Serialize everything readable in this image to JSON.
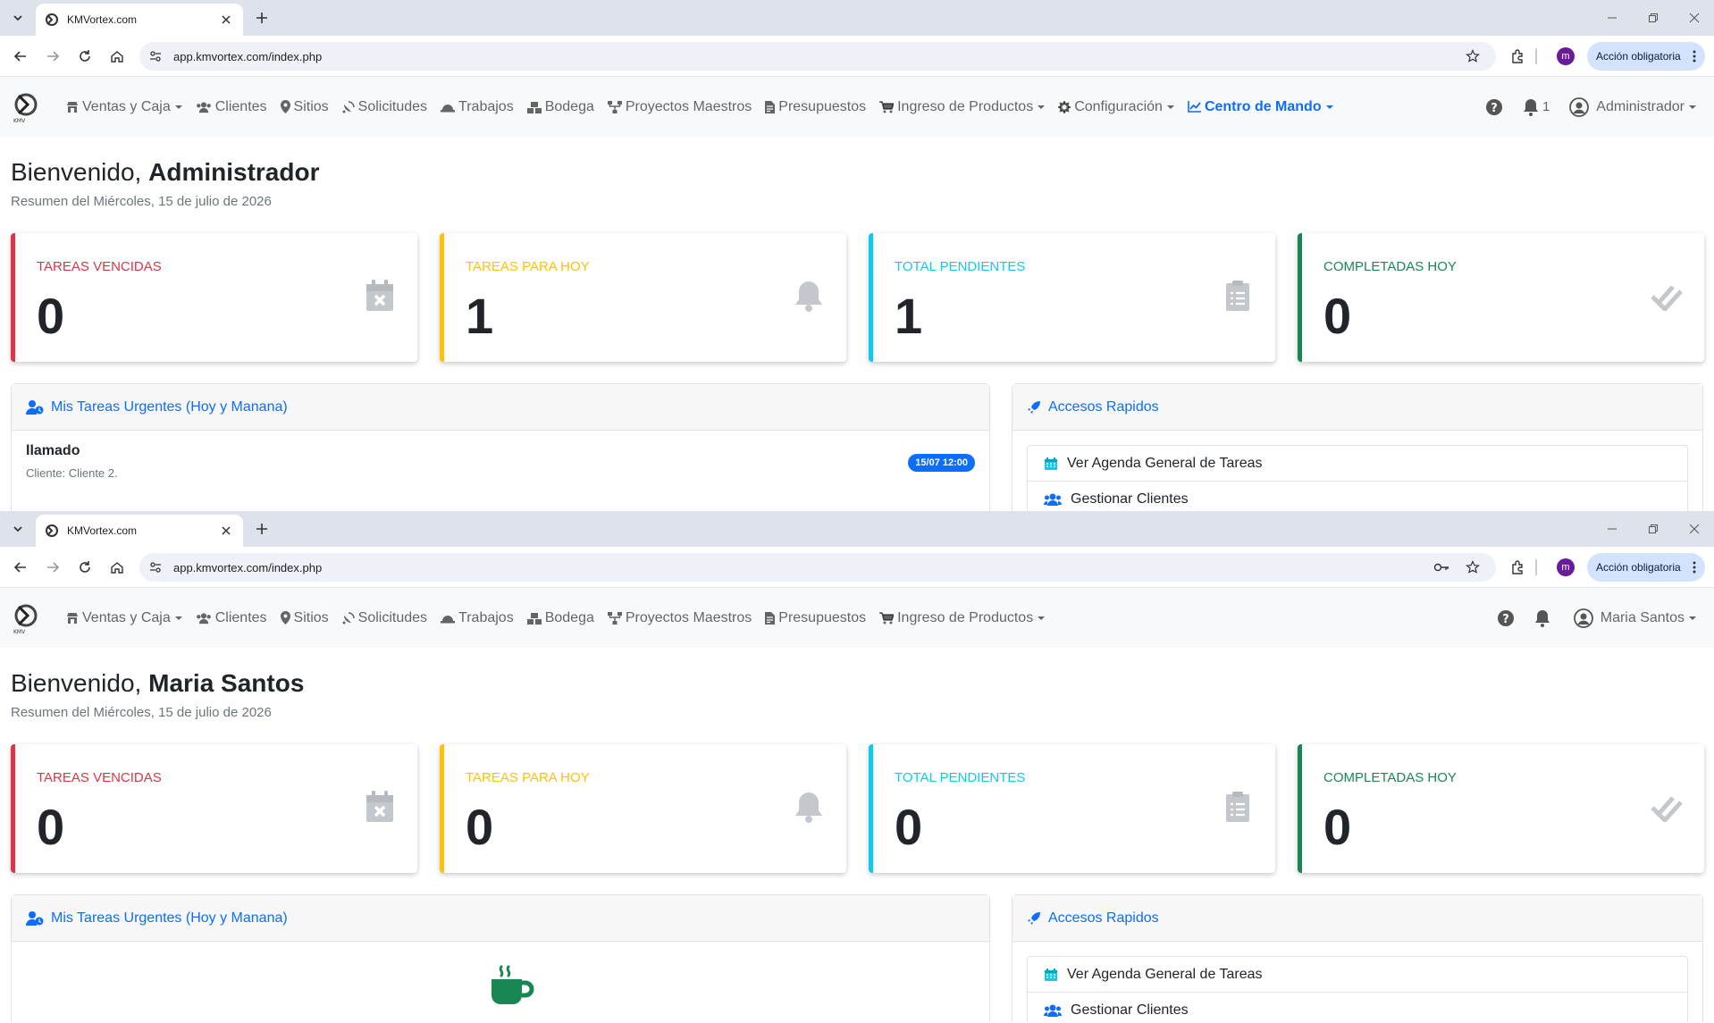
{
  "windows": [
    {
      "browser": {
        "tab_title": "KMVortex.com",
        "url": "app.kmvortex.com/index.php",
        "profile_initial": "m",
        "action_label": "Acción obligatoria"
      },
      "nav": {
        "items": [
          {
            "label": "Ventas y Caja",
            "icon": "store-icon",
            "dropdown": true
          },
          {
            "label": "Clientes",
            "icon": "users-icon",
            "dropdown": false
          },
          {
            "label": "Sitios",
            "icon": "map-marker-icon",
            "dropdown": false
          },
          {
            "label": "Solicitudes",
            "icon": "satellite-dish-icon",
            "dropdown": false
          },
          {
            "label": "Trabajos",
            "icon": "hard-hat-icon",
            "dropdown": false
          },
          {
            "label": "Bodega",
            "icon": "boxes-icon",
            "dropdown": false
          },
          {
            "label": "Proyectos Maestros",
            "icon": "sitemap-icon",
            "dropdown": false
          },
          {
            "label": "Presupuestos",
            "icon": "file-invoice-icon",
            "dropdown": false
          },
          {
            "label": "Ingreso de Productos",
            "icon": "cart-icon",
            "dropdown": true
          },
          {
            "label": "Configuración",
            "icon": "gear-icon",
            "dropdown": true
          },
          {
            "label": "Centro de Mando",
            "icon": "chart-line-icon",
            "dropdown": true,
            "active": true
          }
        ],
        "notifications_count": "1",
        "user": "Administrador"
      },
      "welcome_prefix": "Bienvenido,",
      "welcome_name": "Administrador",
      "subtitle": "Resumen del Miércoles, 15 de julio de 2026",
      "stats": [
        {
          "label": "TAREAS VENCIDAS",
          "value": "0",
          "color": "#dc3545",
          "icon": "calendar-times-icon"
        },
        {
          "label": "TAREAS PARA HOY",
          "value": "1",
          "color": "#ffc107",
          "icon": "bell-icon"
        },
        {
          "label": "TOTAL PENDIENTES",
          "value": "1",
          "color": "#0dcaf0",
          "icon": "clipboard-list-icon"
        },
        {
          "label": "COMPLETADAS HOY",
          "value": "0",
          "color": "#198754",
          "icon": "check-double-icon"
        }
      ],
      "urgent_title": "Mis Tareas Urgentes (Hoy y Manana)",
      "urgent_tasks": [
        {
          "title": "llamado",
          "client": "Cliente: Cliente 2.",
          "badge": "15/07 12:00"
        }
      ],
      "quick_title": "Accesos Rapidos",
      "quick_links": [
        "Ver Agenda General de Tareas",
        "Gestionar Clientes"
      ]
    },
    {
      "browser": {
        "tab_title": "KMVortex.com",
        "url": "app.kmvortex.com/index.php",
        "profile_initial": "m",
        "action_label": "Acción obligatoria"
      },
      "nav": {
        "items": [
          {
            "label": "Ventas y Caja",
            "icon": "store-icon",
            "dropdown": true
          },
          {
            "label": "Clientes",
            "icon": "users-icon",
            "dropdown": false
          },
          {
            "label": "Sitios",
            "icon": "map-marker-icon",
            "dropdown": false
          },
          {
            "label": "Solicitudes",
            "icon": "satellite-dish-icon",
            "dropdown": false
          },
          {
            "label": "Trabajos",
            "icon": "hard-hat-icon",
            "dropdown": false
          },
          {
            "label": "Bodega",
            "icon": "boxes-icon",
            "dropdown": false
          },
          {
            "label": "Proyectos Maestros",
            "icon": "sitemap-icon",
            "dropdown": false
          },
          {
            "label": "Presupuestos",
            "icon": "file-invoice-icon",
            "dropdown": false
          },
          {
            "label": "Ingreso de Productos",
            "icon": "cart-icon",
            "dropdown": true
          }
        ],
        "notifications_count": "",
        "user": "Maria Santos"
      },
      "welcome_prefix": "Bienvenido,",
      "welcome_name": "Maria Santos",
      "subtitle": "Resumen del Miércoles, 15 de julio de 2026",
      "stats": [
        {
          "label": "TAREAS VENCIDAS",
          "value": "0",
          "color": "#dc3545",
          "icon": "calendar-times-icon"
        },
        {
          "label": "TAREAS PARA HOY",
          "value": "0",
          "color": "#ffc107",
          "icon": "bell-icon"
        },
        {
          "label": "TOTAL PENDIENTES",
          "value": "0",
          "color": "#0dcaf0",
          "icon": "clipboard-list-icon"
        },
        {
          "label": "COMPLETADAS HOY",
          "value": "0",
          "color": "#198754",
          "icon": "check-double-icon"
        }
      ],
      "urgent_title": "Mis Tareas Urgentes (Hoy y Manana)",
      "urgent_tasks": [],
      "quick_title": "Accesos Rapidos",
      "quick_links": [
        "Ver Agenda General de Tareas",
        "Gestionar Clientes"
      ]
    }
  ]
}
